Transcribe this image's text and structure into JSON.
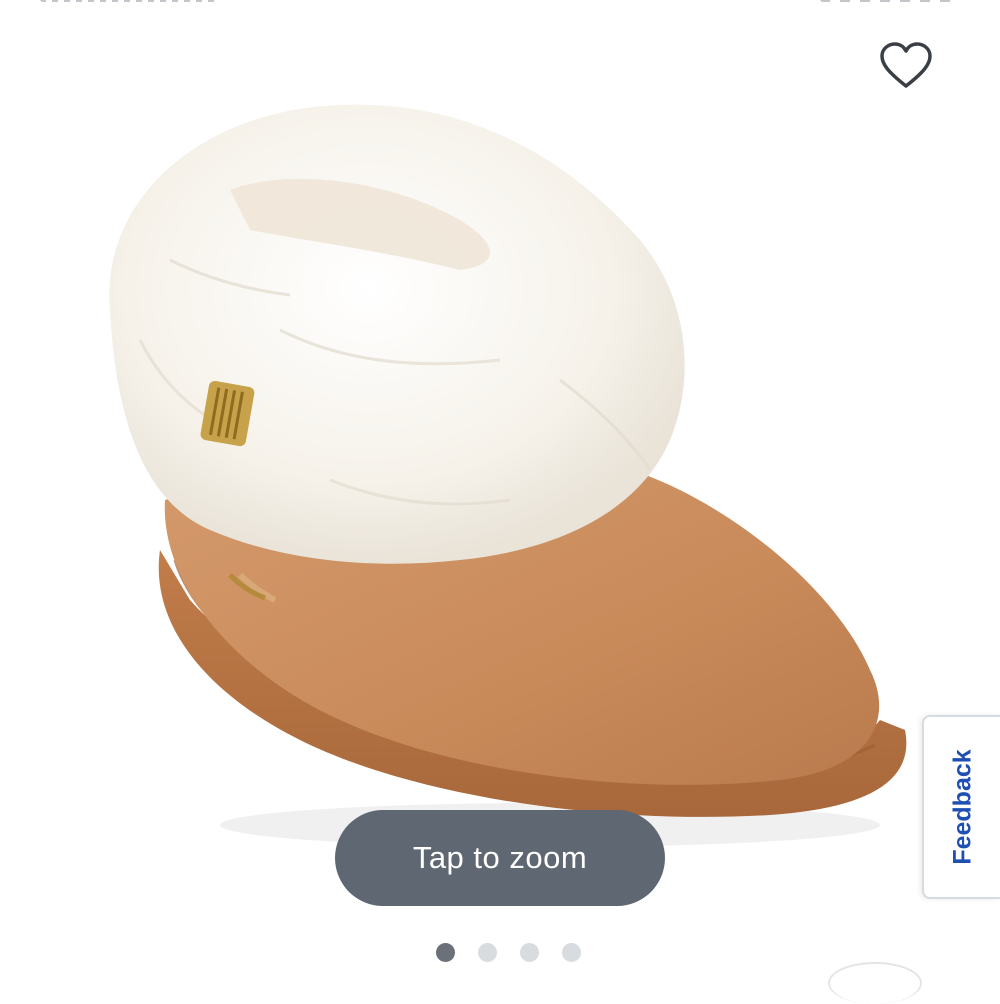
{
  "product": {
    "image_alt": "Tan suede ankle slipper bootie with white faux fur cuff and gold stitched tab"
  },
  "favorite": {
    "icon": "heart-outline-icon"
  },
  "zoom": {
    "label": "Tap to zoom"
  },
  "feedback": {
    "label": "Feedback",
    "color": "#1f4fb3"
  },
  "carousel": {
    "total": 4,
    "active_index": 0
  },
  "colors": {
    "pill_bg": "#5f6872",
    "dot_active": "#6b7178",
    "dot_inactive": "#d9dcdf"
  }
}
